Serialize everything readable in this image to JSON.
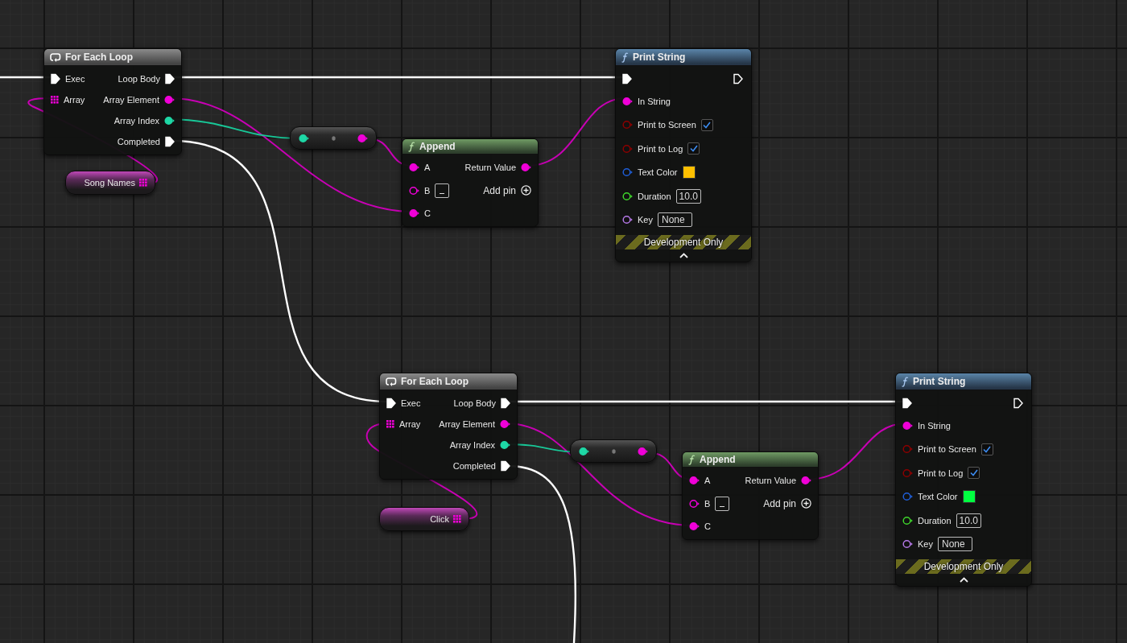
{
  "graph": {
    "nodes": [
      {
        "kind": "for_each",
        "title": "For Each Loop",
        "inputs": [
          {
            "label": "Exec",
            "kind": "exec",
            "connected": true
          },
          {
            "label": "Array",
            "kind": "array",
            "connected": true
          }
        ],
        "outputs": [
          {
            "label": "Loop Body",
            "kind": "exec",
            "connected": true
          },
          {
            "label": "Array Element",
            "kind": "string",
            "connected": true
          },
          {
            "label": "Array Index",
            "kind": "int",
            "connected": true
          },
          {
            "label": "Completed",
            "kind": "exec",
            "connected": true
          }
        ]
      },
      {
        "kind": "variable",
        "label": "Song Names",
        "pin": {
          "kind": "array",
          "connected": true
        }
      },
      {
        "kind": "convert",
        "input": {
          "kind": "int",
          "connected": true
        },
        "output": {
          "kind": "string",
          "connected": true
        }
      },
      {
        "kind": "append",
        "title": "Append",
        "inputs": [
          {
            "label": "A",
            "kind": "string",
            "connected": true
          },
          {
            "label": "B",
            "kind": "string",
            "connected": false
          },
          {
            "label": "C",
            "kind": "string",
            "connected": true
          }
        ],
        "outputs": [
          {
            "label": "Return Value",
            "kind": "string",
            "connected": true
          }
        ],
        "add_pin": "Add pin"
      },
      {
        "kind": "print_string",
        "title": "Print String",
        "exec_in": {
          "connected": true
        },
        "exec_out": {
          "connected": false
        },
        "inputs": [
          {
            "label": "In String",
            "kind": "string",
            "connected": true
          },
          {
            "label": "Print to Screen",
            "kind": "bool",
            "connected": false,
            "checked": true
          },
          {
            "label": "Print to Log",
            "kind": "bool",
            "connected": false,
            "checked": true
          },
          {
            "label": "Text Color",
            "kind": "color",
            "connected": false,
            "color": "#ffc000"
          },
          {
            "label": "Duration",
            "kind": "float",
            "connected": false,
            "value": "10.0"
          },
          {
            "label": "Key",
            "kind": "name",
            "connected": false,
            "value": "None"
          }
        ],
        "footer": "Development Only"
      },
      {
        "kind": "for_each",
        "title": "For Each Loop",
        "inputs": [
          {
            "label": "Exec",
            "kind": "exec",
            "connected": true
          },
          {
            "label": "Array",
            "kind": "array",
            "connected": true
          }
        ],
        "outputs": [
          {
            "label": "Loop Body",
            "kind": "exec",
            "connected": true
          },
          {
            "label": "Array Element",
            "kind": "string",
            "connected": true
          },
          {
            "label": "Array Index",
            "kind": "int",
            "connected": true
          },
          {
            "label": "Completed",
            "kind": "exec",
            "connected": true
          }
        ]
      },
      {
        "kind": "variable",
        "label": "Click",
        "pin": {
          "kind": "array",
          "connected": true
        }
      },
      {
        "kind": "convert",
        "input": {
          "kind": "int",
          "connected": true
        },
        "output": {
          "kind": "string",
          "connected": true
        }
      },
      {
        "kind": "append",
        "title": "Append",
        "inputs": [
          {
            "label": "A",
            "kind": "string",
            "connected": true
          },
          {
            "label": "B",
            "kind": "string",
            "connected": false
          },
          {
            "label": "C",
            "kind": "string",
            "connected": true
          }
        ],
        "outputs": [
          {
            "label": "Return Value",
            "kind": "string",
            "connected": true
          }
        ],
        "add_pin": "Add pin"
      },
      {
        "kind": "print_string",
        "title": "Print String",
        "exec_in": {
          "connected": true
        },
        "exec_out": {
          "connected": false
        },
        "inputs": [
          {
            "label": "In String",
            "kind": "string",
            "connected": true
          },
          {
            "label": "Print to Screen",
            "kind": "bool",
            "connected": false,
            "checked": true
          },
          {
            "label": "Print to Log",
            "kind": "bool",
            "connected": false,
            "checked": true
          },
          {
            "label": "Text Color",
            "kind": "color",
            "connected": false,
            "color": "#00ff40"
          },
          {
            "label": "Duration",
            "kind": "float",
            "connected": false,
            "value": "10.0"
          },
          {
            "label": "Key",
            "kind": "name",
            "connected": false,
            "value": "None"
          }
        ],
        "footer": "Development Only"
      }
    ]
  }
}
